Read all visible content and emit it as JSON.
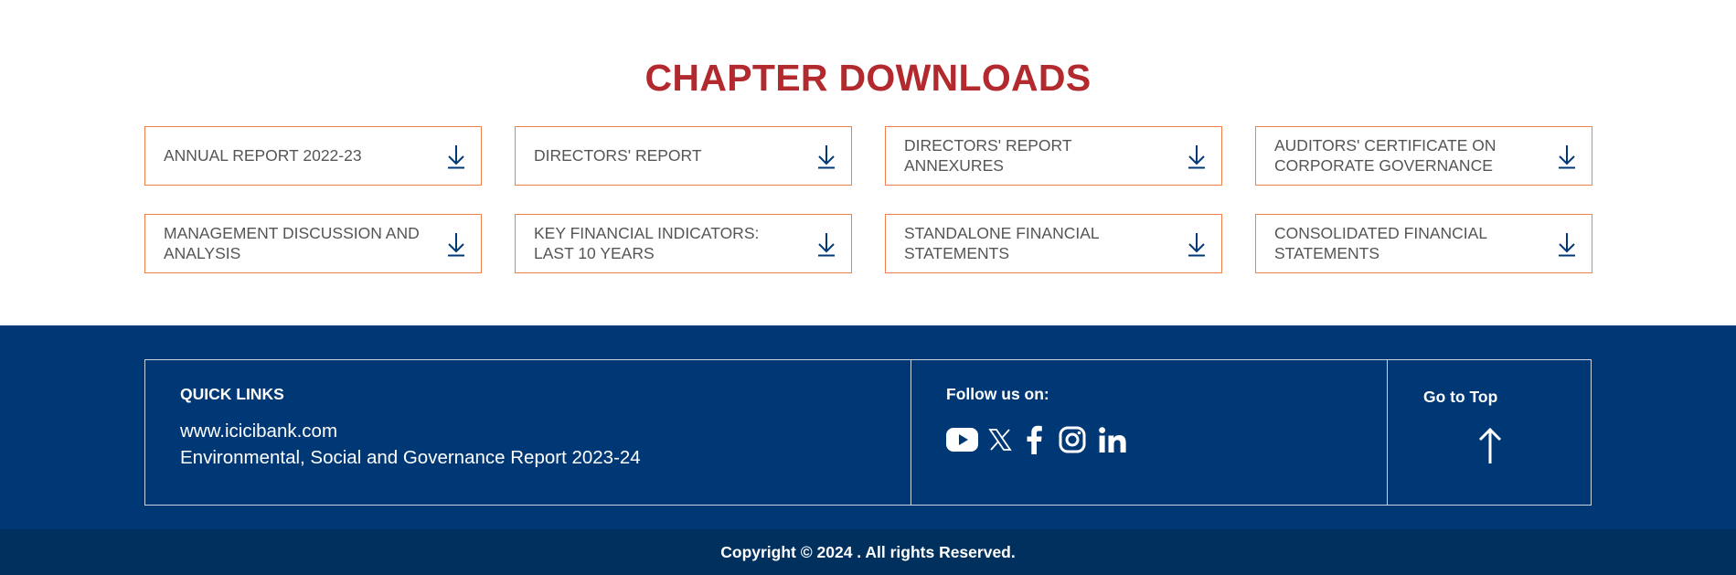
{
  "downloads": {
    "title": "CHAPTER DOWNLOADS",
    "items": [
      {
        "label": "ANNUAL REPORT 2022-23"
      },
      {
        "label": "DIRECTORS' REPORT"
      },
      {
        "label": "DIRECTORS' REPORT ANNEXURES"
      },
      {
        "label": "AUDITORS' CERTIFICATE ON CORPORATE GOVERNANCE"
      },
      {
        "label": "MANAGEMENT DISCUSSION AND ANALYSIS"
      },
      {
        "label": "KEY FINANCIAL INDICATORS: LAST 10 YEARS"
      },
      {
        "label": "STANDALONE FINANCIAL STATEMENTS"
      },
      {
        "label": "CONSOLIDATED FINANCIAL STATEMENTS"
      }
    ],
    "icon": "download-icon",
    "colors": {
      "title": "#b22a2e",
      "card_border": "#f0804a",
      "icon": "#003876"
    }
  },
  "footer": {
    "quick_links": {
      "heading": "QUICK LINKS",
      "links": [
        "www.icicibank.com",
        "Environmental, Social and Governance Report 2023-24"
      ]
    },
    "follow": {
      "label": "Follow us on:",
      "icons": [
        "youtube-icon",
        "x-twitter-icon",
        "facebook-icon",
        "instagram-icon",
        "linkedin-icon"
      ]
    },
    "goto_top": {
      "label": "Go to Top",
      "icon": "arrow-up-icon"
    },
    "copyright": "Copyright © 2024 . All rights Reserved.",
    "colors": {
      "background": "#003876",
      "bottom_bar": "#00305e"
    }
  }
}
